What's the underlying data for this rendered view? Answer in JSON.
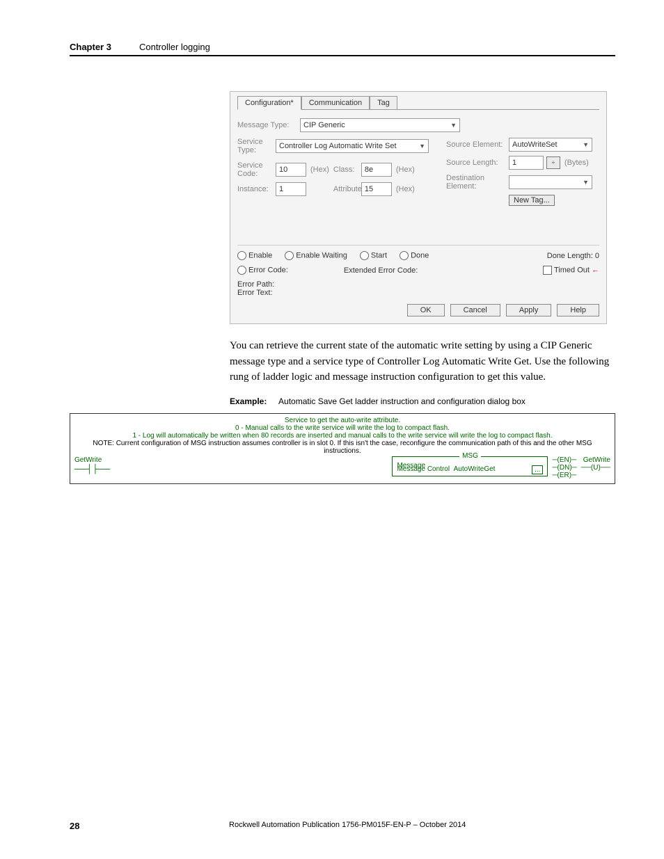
{
  "header": {
    "chapter_label": "Chapter 3",
    "chapter_title": "Controller logging"
  },
  "dialog": {
    "tabs": [
      "Configuration*",
      "Communication",
      "Tag"
    ],
    "active_tab": 0,
    "message_type_label": "Message Type:",
    "message_type_value": "CIP Generic",
    "service_type_label": "Service Type:",
    "service_type_value": "Controller Log Automatic Write Set",
    "service_code_label": "Service Code:",
    "service_code_value": "10",
    "instance_label": "Instance:",
    "instance_value": "1",
    "class_label": "Class:",
    "class_value": "8e",
    "attribute_label": "Attribute:",
    "attribute_value": "15",
    "hex_label": "(Hex)",
    "source_element_label": "Source Element:",
    "source_element_value": "AutoWriteSet",
    "source_length_label": "Source Length:",
    "source_length_value": "1",
    "bytes_label": "(Bytes)",
    "destination_element_label": "Destination Element:",
    "destination_element_value": "",
    "new_tag_label": "New Tag...",
    "status": {
      "enable": "Enable",
      "enable_waiting": "Enable Waiting",
      "start": "Start",
      "done": "Done",
      "done_length_label": "Done Length:",
      "done_length_value": "0",
      "error_code_label": "Error Code:",
      "extended_error_label": "Extended Error Code:",
      "timed_out_label": "Timed Out",
      "error_path_label": "Error Path:",
      "error_text_label": "Error Text:"
    },
    "buttons": {
      "ok": "OK",
      "cancel": "Cancel",
      "apply": "Apply",
      "help": "Help"
    }
  },
  "body_paragraph": "You can retrieve the current state of the automatic write setting by using a CIP Generic message type and a service type of Controller Log Automatic Write Get. Use the following rung of ladder logic and message instruction configuration to get this value.",
  "example": {
    "label": "Example:",
    "caption": "Automatic Save Get ladder instruction and configuration dialog box"
  },
  "ladder": {
    "desc_line1": "Service to get the auto-write attribute.",
    "desc_line2": "0 - Manual calls to the write service will write the log to compact flash.",
    "desc_line3": "1 - Log will automatically be written when 80 records are inserted and manual calls to the write service will write the log to compact flash.",
    "desc_line4": "NOTE: Current configuration of MSG instruction assumes controller is in slot 0. If this isn't the case, reconfigure the communication path of this and the other MSG instructions.",
    "rung_name": "GetWrite",
    "rung_name_right": "GetWrite",
    "msg_block_title": "MSG",
    "msg_line1_left": "Message",
    "msg_line2_left": "Message Control",
    "msg_line2_right": "AutoWriteGet",
    "config_btn": "...",
    "coils": [
      "EN",
      "DN",
      "ER"
    ],
    "unlatch": "U"
  },
  "footer": {
    "page": "28",
    "publication": "Rockwell Automation Publication 1756-PM015F-EN-P – October 2014"
  }
}
